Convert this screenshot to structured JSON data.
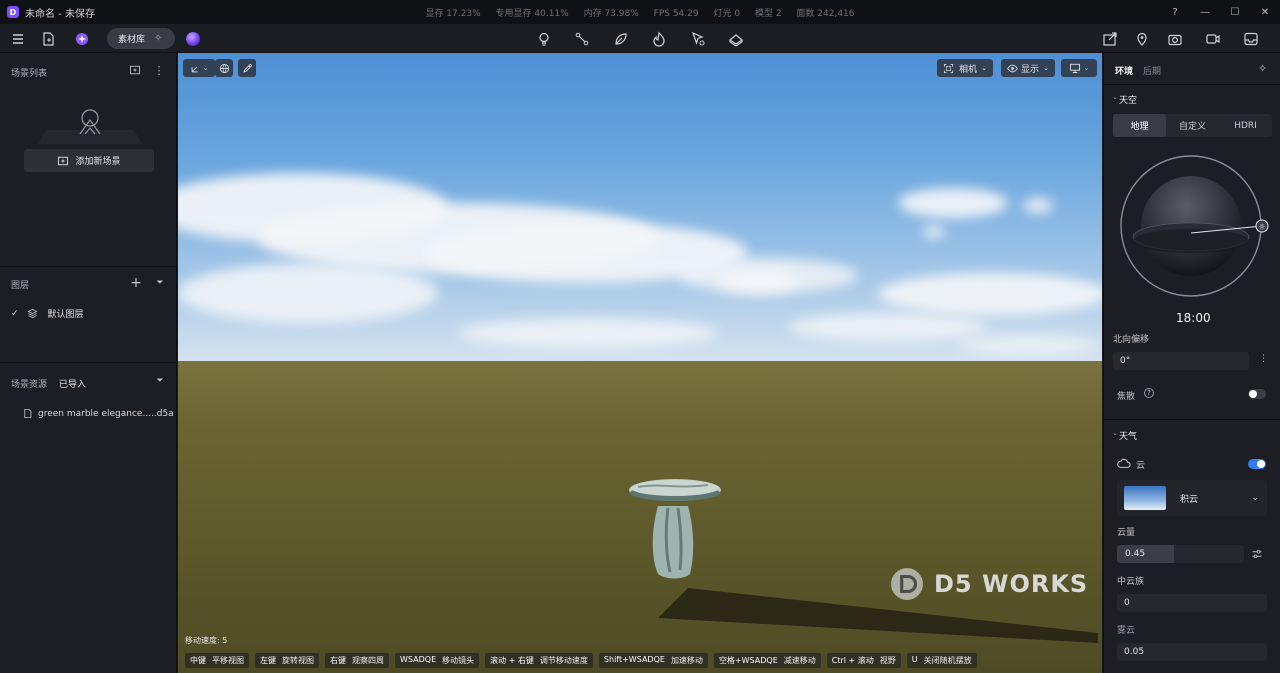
{
  "title": "未命名 - 未保存",
  "stats": [
    "显存 17.23%",
    "专用显存 40.11%",
    "内存 73.98%",
    "FPS 54.29",
    "灯光 0",
    "模型 2",
    "面数 242,416"
  ],
  "window_buttons": [
    "?",
    "—",
    "☐",
    "✕"
  ],
  "toolbar": {
    "material_library": "素材库"
  },
  "left": {
    "scene_list_title": "场景列表",
    "add_scene": "添加新场景",
    "layers_title": "图层",
    "default_layer": "默认图层",
    "assets_title": "场景资源",
    "assets_tab": "已导入",
    "asset_file": "green marble elegance.....d5a"
  },
  "viewport": {
    "camera": "相机",
    "display": "显示",
    "move_speed": "移动速度: 5",
    "hints": [
      {
        "key": "中键",
        "desc": "平移视图"
      },
      {
        "key": "左键",
        "desc": "旋转视图"
      },
      {
        "key": "右键",
        "desc": "观察四周"
      },
      {
        "key": "WSADQE",
        "desc": "移动镜头"
      },
      {
        "key": "滚动 + 右键",
        "desc": "调节移动速度"
      },
      {
        "key": "Shift+WSADQE",
        "desc": "加速移动"
      },
      {
        "key": "空格+WSADQE",
        "desc": "减速移动"
      },
      {
        "key": "Ctrl + 滚动",
        "desc": "视野"
      },
      {
        "key": "U",
        "desc": "关闭随机摆放"
      }
    ],
    "watermark": "D5 WORKS"
  },
  "right": {
    "tab_env": "环境",
    "tab_post": "后期",
    "sky_title": "天空",
    "sky_tabs": [
      "地理",
      "自定义",
      "HDRI"
    ],
    "time": "18:00",
    "north_offset_label": "北向偏移",
    "north_offset_value": "0°",
    "focus_label": "焦散",
    "focus_on": false,
    "weather_title": "天气",
    "cloud_label": "云",
    "cloud_on": true,
    "cloud_type": "积云",
    "cloud_amount_label": "云量",
    "cloud_amount_value": "0.45",
    "cloud_amount_fraction": 0.45,
    "mid_cloud_label": "中云族",
    "mid_cloud_value": "0",
    "fourth_label": "雾云",
    "fourth_value": "0.05"
  },
  "colors": {
    "accent": "#2f7cf6",
    "panel": "#1d1e23",
    "brand": "#7b4dff"
  }
}
